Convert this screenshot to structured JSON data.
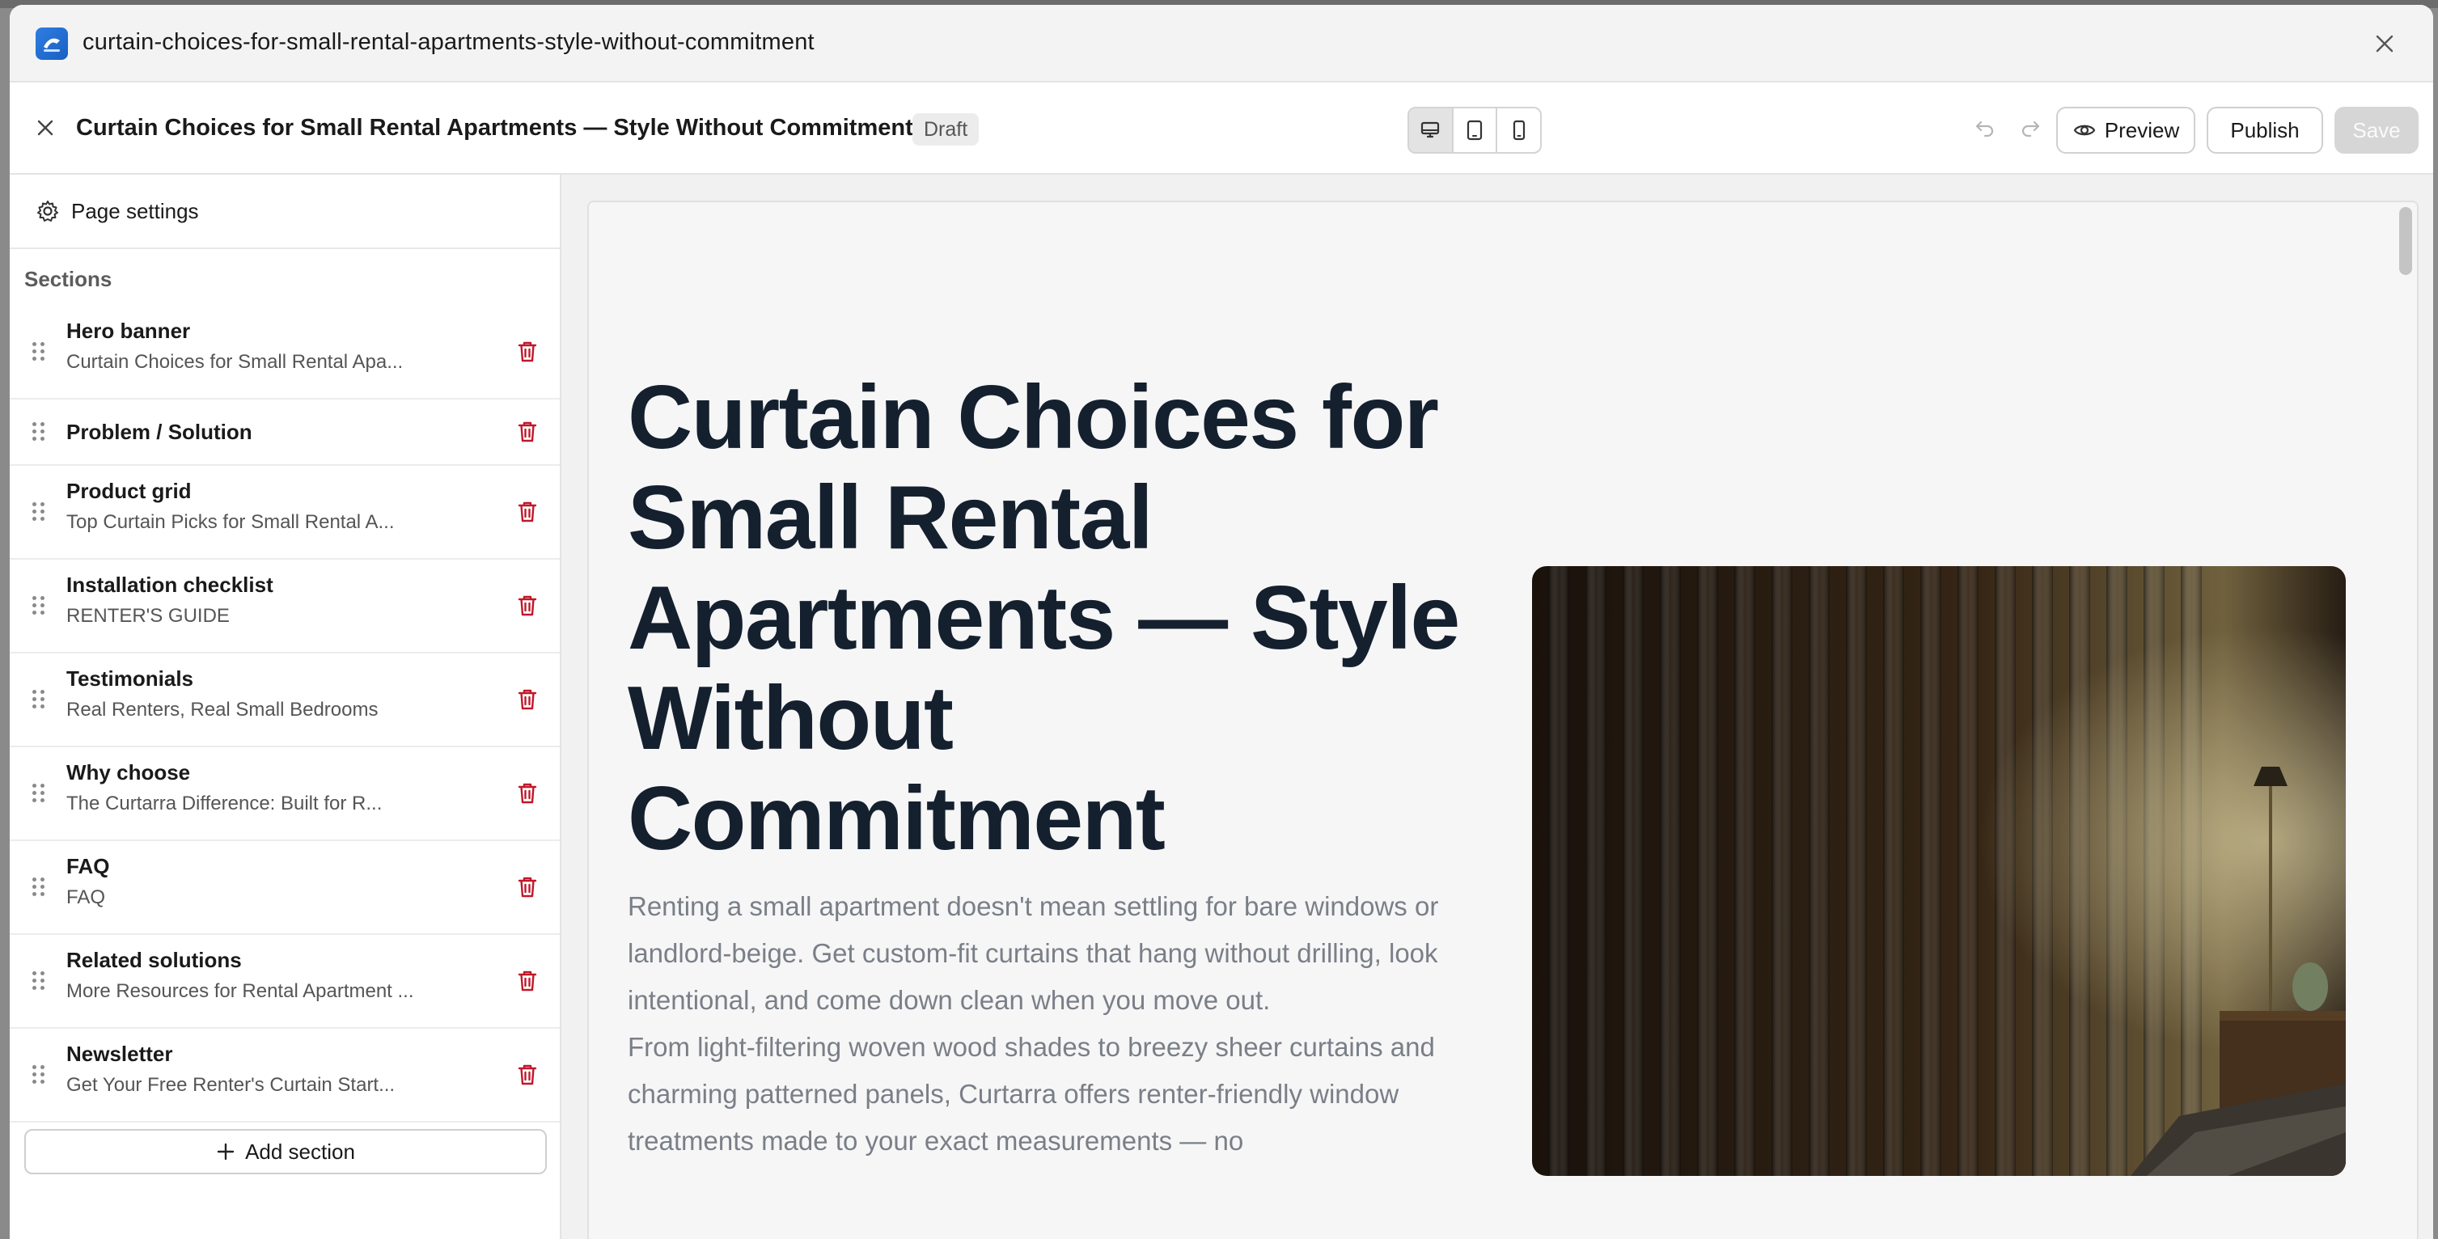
{
  "window": {
    "title": "curtain-choices-for-small-rental-apartments-style-without-commitment",
    "app_icon": "app-logo-icon",
    "close_icon": "close-icon"
  },
  "header": {
    "page_title": "Curtain Choices for Small Rental Apartments — Style Without Commitment",
    "status_badge": "Draft",
    "devices": [
      {
        "name": "desktop",
        "icon": "desktop-icon",
        "active": true
      },
      {
        "name": "tablet",
        "icon": "tablet-icon",
        "active": false
      },
      {
        "name": "mobile",
        "icon": "mobile-icon",
        "active": false
      }
    ],
    "preview_label": "Preview",
    "publish_label": "Publish",
    "save_label": "Save"
  },
  "sidebar": {
    "page_settings_label": "Page settings",
    "sections_heading": "Sections",
    "sections": [
      {
        "title": "Hero banner",
        "subtitle": "Curtain Choices for Small Rental Apa..."
      },
      {
        "title": "Problem / Solution",
        "subtitle": ""
      },
      {
        "title": "Product grid",
        "subtitle": "Top Curtain Picks for Small Rental A..."
      },
      {
        "title": "Installation checklist",
        "subtitle": "RENTER'S GUIDE"
      },
      {
        "title": "Testimonials",
        "subtitle": "Real Renters, Real Small Bedrooms"
      },
      {
        "title": "Why choose",
        "subtitle": "The Curtarra Difference: Built for R..."
      },
      {
        "title": "FAQ",
        "subtitle": "FAQ"
      },
      {
        "title": "Related solutions",
        "subtitle": "More Resources for Rental Apartment ..."
      },
      {
        "title": "Newsletter",
        "subtitle": "Get Your Free Renter's Curtain Start..."
      }
    ],
    "add_section_label": "Add section"
  },
  "canvas": {
    "hero_heading": "Curtain Choices for Small Rental Apartments — Style Without Commitment",
    "hero_paragraph_1": "Renting a small apartment doesn't mean settling for bare windows or landlord-beige. Get custom-fit curtains that hang without drilling, look intentional, and come down clean when you move out.",
    "hero_paragraph_2": "From light-filtering woven wood shades to breezy sheer curtains and charming patterned panels, Curtarra offers renter-friendly window treatments made to your exact measurements — no"
  },
  "colors": {
    "heading": "#14202e",
    "body_text": "#7a7f87",
    "delete": "#c0182a",
    "save_disabled": "#d6d6d6"
  }
}
